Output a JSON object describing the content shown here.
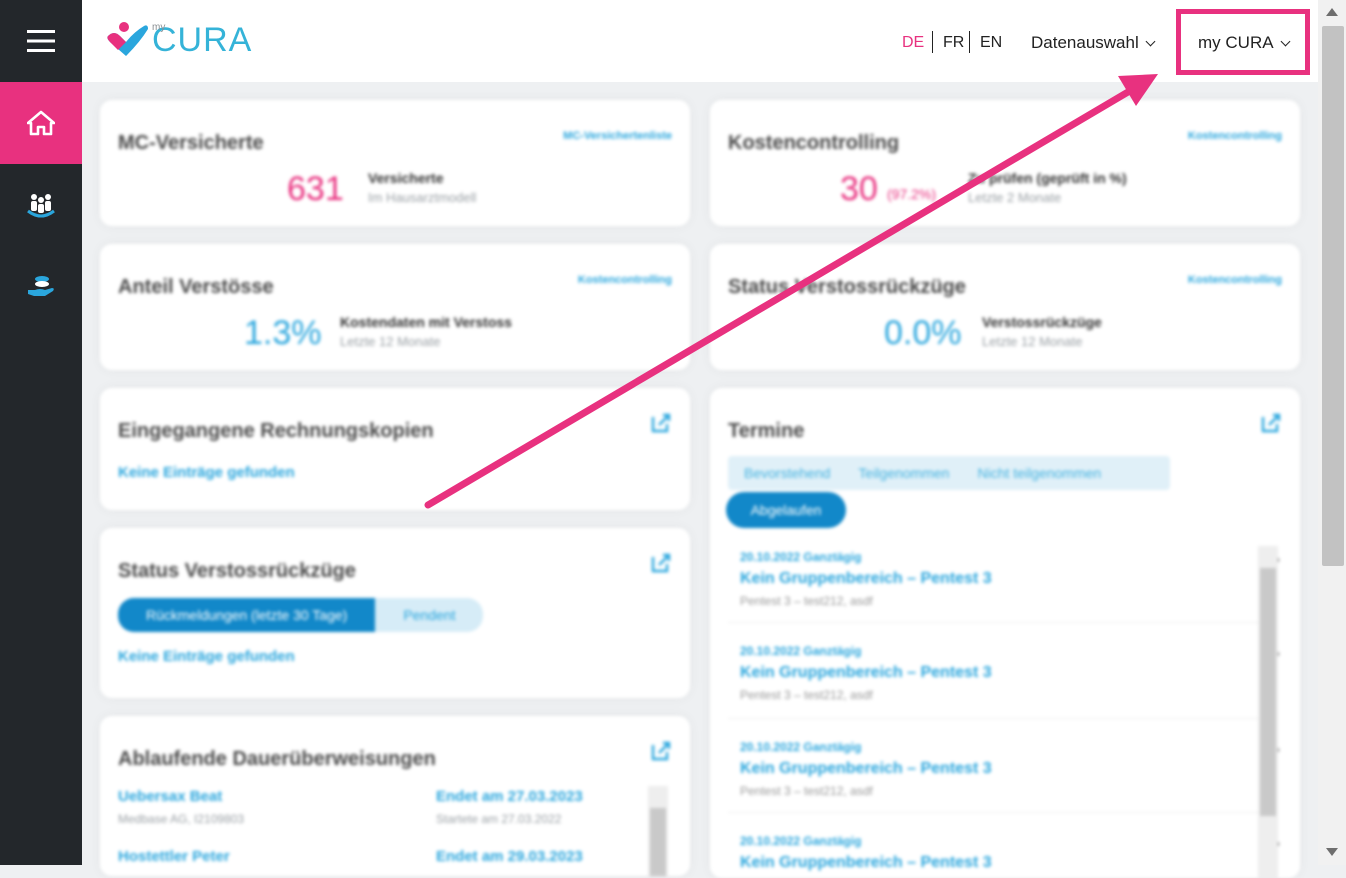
{
  "header": {
    "logo_my": "my",
    "logo_word": "CURA",
    "languages": [
      {
        "code": "DE",
        "active": true
      },
      {
        "code": "FR",
        "active": false
      },
      {
        "code": "EN",
        "active": false
      }
    ],
    "data_selection": "Datenauswahl",
    "user_menu": "my CURA"
  },
  "colors": {
    "accent": "#e8317f",
    "link": "#2aa6dd",
    "sidebar": "#23272b"
  },
  "sidebar": {
    "items": [
      {
        "icon": "hamburger-menu-icon"
      },
      {
        "icon": "home-icon",
        "active": true
      },
      {
        "icon": "people-group-icon"
      },
      {
        "icon": "hand-coins-icon"
      }
    ]
  },
  "cards": {
    "insured": {
      "title": "MC-Versicherte",
      "link": "MC-Versichertenliste",
      "value": "631",
      "label": "Versicherte",
      "sub": "Im Hausarztmodell"
    },
    "cost": {
      "title": "Kostencontrolling",
      "link": "Kostencontrolling",
      "value": "30",
      "value_suffix": "(97.2%)",
      "label": "Zu prüfen (geprüft in %)",
      "sub": "Letzte 2 Monate"
    },
    "violations": {
      "title": "Anteil Verstösse",
      "link": "Kostencontrolling",
      "value": "1.3%",
      "label": "Kostendaten mit Verstoss",
      "sub": "Letzte 12 Monate"
    },
    "withdrawals_status": {
      "title": "Status Verstossrückzüge",
      "link": "Kostencontrolling",
      "value": "0.0%",
      "label": "Verstossrückzüge",
      "sub": "Letzte 12 Monate"
    },
    "invoices": {
      "title": "Eingegangene Rechnungskopien",
      "empty": "Keine Einträge gefunden"
    },
    "withdrawals": {
      "title": "Status Verstossrückzüge",
      "seg_on": "Rückmeldungen (letzte 30 Tage)",
      "seg_off": "Pendent",
      "empty": "Keine Einträge gefunden"
    },
    "transfers": {
      "title": "Ablaufende Dauerüberweisungen",
      "rows": [
        {
          "name": "Uebersax Beat",
          "sub": "Medbase AG, I2109803",
          "end": "Endet am 27.03.2023",
          "start": "Startete am 27.03.2022"
        },
        {
          "name": "Hostettler Peter",
          "sub": "",
          "end": "Endet am 29.03.2023",
          "start": ""
        }
      ]
    },
    "appointments": {
      "title": "Termine",
      "tabs": [
        "Bevorstehend",
        "Teilgenommen",
        "Nicht teilgenommen"
      ],
      "tab_active": "Abgelaufen",
      "items": [
        {
          "date": "20.10.2022 Ganztägig",
          "title": "Kein Gruppenbereich – Pentest 3",
          "sub": "Pentest 3 – test212, asdf"
        },
        {
          "date": "20.10.2022 Ganztägig",
          "title": "Kein Gruppenbereich – Pentest 3",
          "sub": "Pentest 3 – test212, asdf"
        },
        {
          "date": "20.10.2022 Ganztägig",
          "title": "Kein Gruppenbereich – Pentest 3",
          "sub": "Pentest 3 – test212, asdf"
        },
        {
          "date": "20.10.2022 Ganztägig",
          "title": "Kein Gruppenbereich – Pentest 3",
          "sub": ""
        }
      ]
    }
  }
}
